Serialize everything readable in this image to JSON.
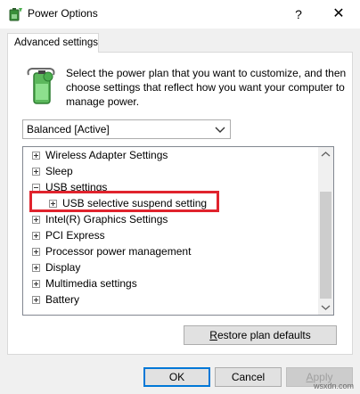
{
  "window": {
    "title": "Power Options",
    "help_label": "?",
    "close_label": "✕",
    "icon": "power-options-icon"
  },
  "tab": {
    "label": "Advanced settings"
  },
  "description": "Select the power plan that you want to customize, and then choose settings that reflect how you want your computer to manage power.",
  "plan_select": {
    "value": "Balanced [Active]"
  },
  "tree": {
    "items": [
      {
        "label": "Wireless Adapter Settings",
        "level": 0,
        "expanded": false
      },
      {
        "label": "Sleep",
        "level": 0,
        "expanded": false
      },
      {
        "label": "USB settings",
        "level": 0,
        "expanded": true
      },
      {
        "label": "USB selective suspend setting",
        "level": 1,
        "expanded": false
      },
      {
        "label": "Intel(R) Graphics Settings",
        "level": 0,
        "expanded": false
      },
      {
        "label": "PCI Express",
        "level": 0,
        "expanded": false
      },
      {
        "label": "Processor power management",
        "level": 0,
        "expanded": false
      },
      {
        "label": "Display",
        "level": 0,
        "expanded": false
      },
      {
        "label": "Multimedia settings",
        "level": 0,
        "expanded": false
      },
      {
        "label": "Battery",
        "level": 0,
        "expanded": false
      }
    ]
  },
  "buttons": {
    "restore": "Restore plan defaults",
    "ok": "OK",
    "cancel": "Cancel",
    "apply": "Apply"
  },
  "watermark": "wsxdn.com",
  "colors": {
    "highlight": "#e0232d",
    "accent": "#0078d7"
  }
}
